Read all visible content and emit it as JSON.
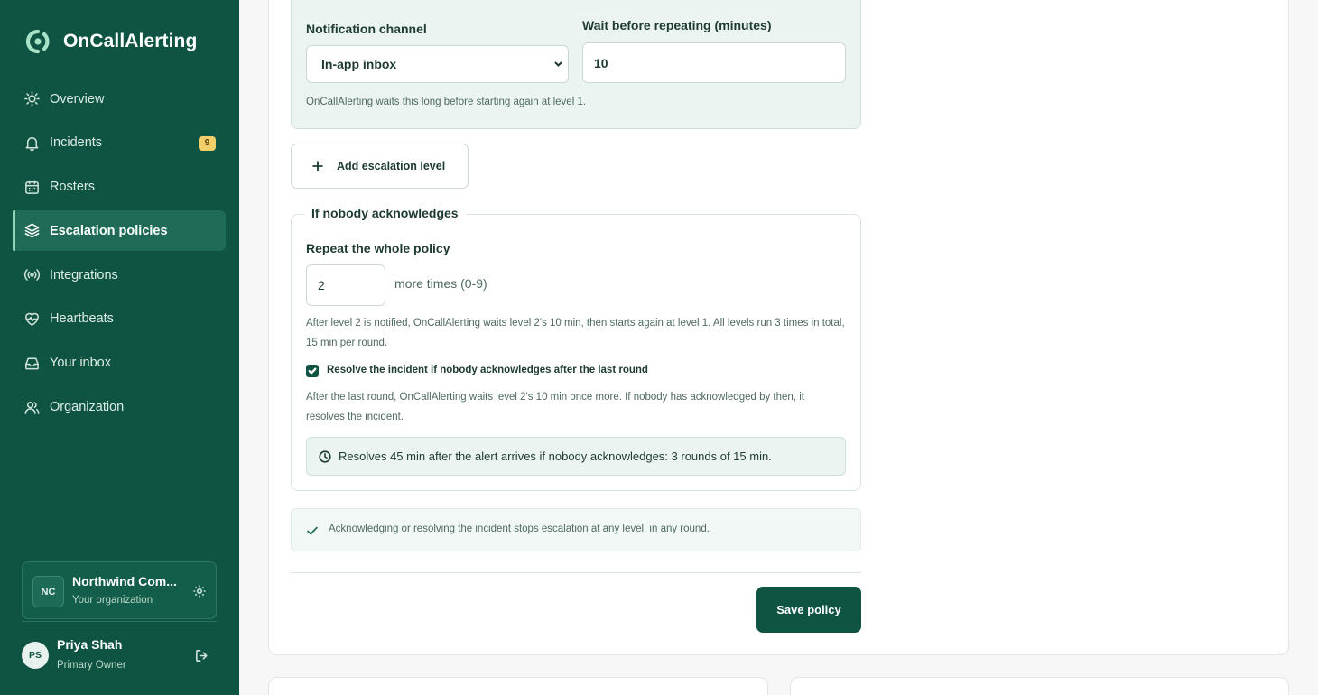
{
  "brand": {
    "name": "OnCallAlerting"
  },
  "nav": {
    "items": [
      {
        "label": "Overview",
        "icon": "sun-icon"
      },
      {
        "label": "Incidents",
        "icon": "bell-icon",
        "badge": "9"
      },
      {
        "label": "Rosters",
        "icon": "calendar-icon"
      },
      {
        "label": "Escalation policies",
        "icon": "layers-icon",
        "active": true
      },
      {
        "label": "Integrations",
        "icon": "broadcast-icon"
      },
      {
        "label": "Heartbeats",
        "icon": "heartbeat-icon"
      },
      {
        "label": "Your inbox",
        "icon": "inbox-icon"
      },
      {
        "label": "Organization",
        "icon": "users-icon"
      }
    ]
  },
  "org": {
    "initials": "NC",
    "name": "Northwind Com...",
    "subtitle": "Your organization"
  },
  "user": {
    "initials": "PS",
    "name": "Priya Shah",
    "role": "Primary Owner"
  },
  "level": {
    "channel_label": "Notification channel",
    "channel_value": "In-app inbox",
    "wait_label": "Wait before repeating (minutes)",
    "wait_value": "10",
    "helper": "OnCallAlerting waits this long before starting again at level 1."
  },
  "add_level": {
    "label": "Add escalation level"
  },
  "no_ack": {
    "legend": "If nobody acknowledges",
    "repeat_label": "Repeat the whole policy",
    "repeat_value": "2",
    "repeat_suffix": "more times (0-9)",
    "repeat_helper": "After level 2 is notified, OnCallAlerting waits level 2's 10 min, then starts again at level 1. All levels run 3 times in total, 15 min per round.",
    "resolve_checked": true,
    "resolve_label": "Resolve the incident if nobody acknowledges after the last round",
    "resolve_helper": "After the last round, OnCallAlerting waits level 2's 10 min once more. If nobody has acknowledged by then, it resolves the incident.",
    "summary": "Resolves 45 min after the alert arrives if nobody acknowledges: 3 rounds of 15 min."
  },
  "ack_note": "Acknowledging or resolving the incident stops escalation at any level, in any round.",
  "save_label": "Save policy",
  "colors": {
    "sidebar": "#0f5443",
    "accent": "#0f5443",
    "badge": "#f3cf6a",
    "panel": "#ebf4f1"
  }
}
